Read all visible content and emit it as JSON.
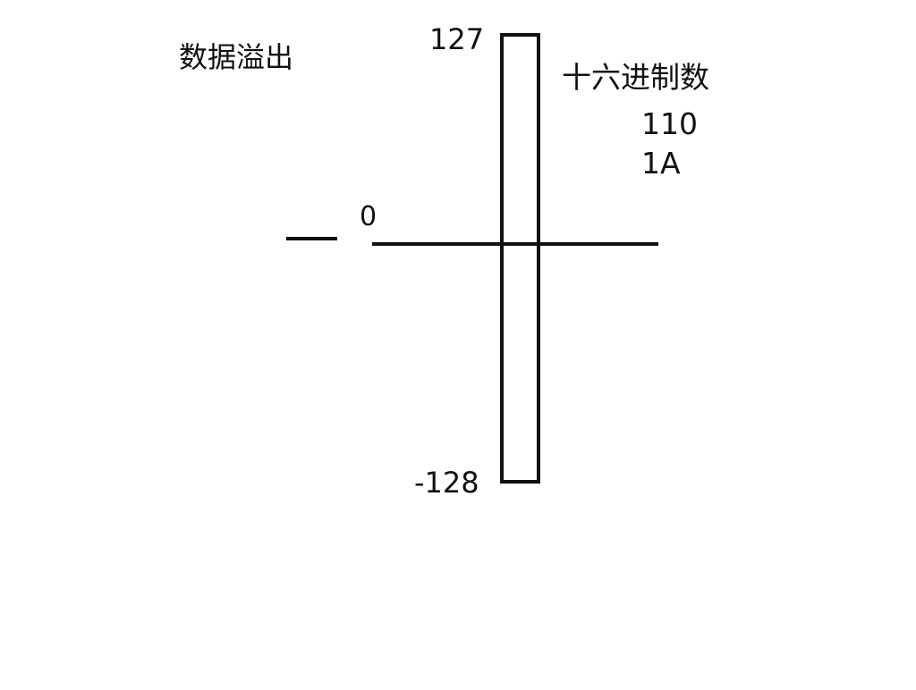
{
  "diagram": {
    "title": "数据溢出",
    "range": {
      "max_label": "127",
      "zero_label": "0",
      "min_label": "-128"
    },
    "hex_panel": {
      "heading": "十六进制数",
      "values": [
        "110",
        "1A"
      ]
    }
  }
}
